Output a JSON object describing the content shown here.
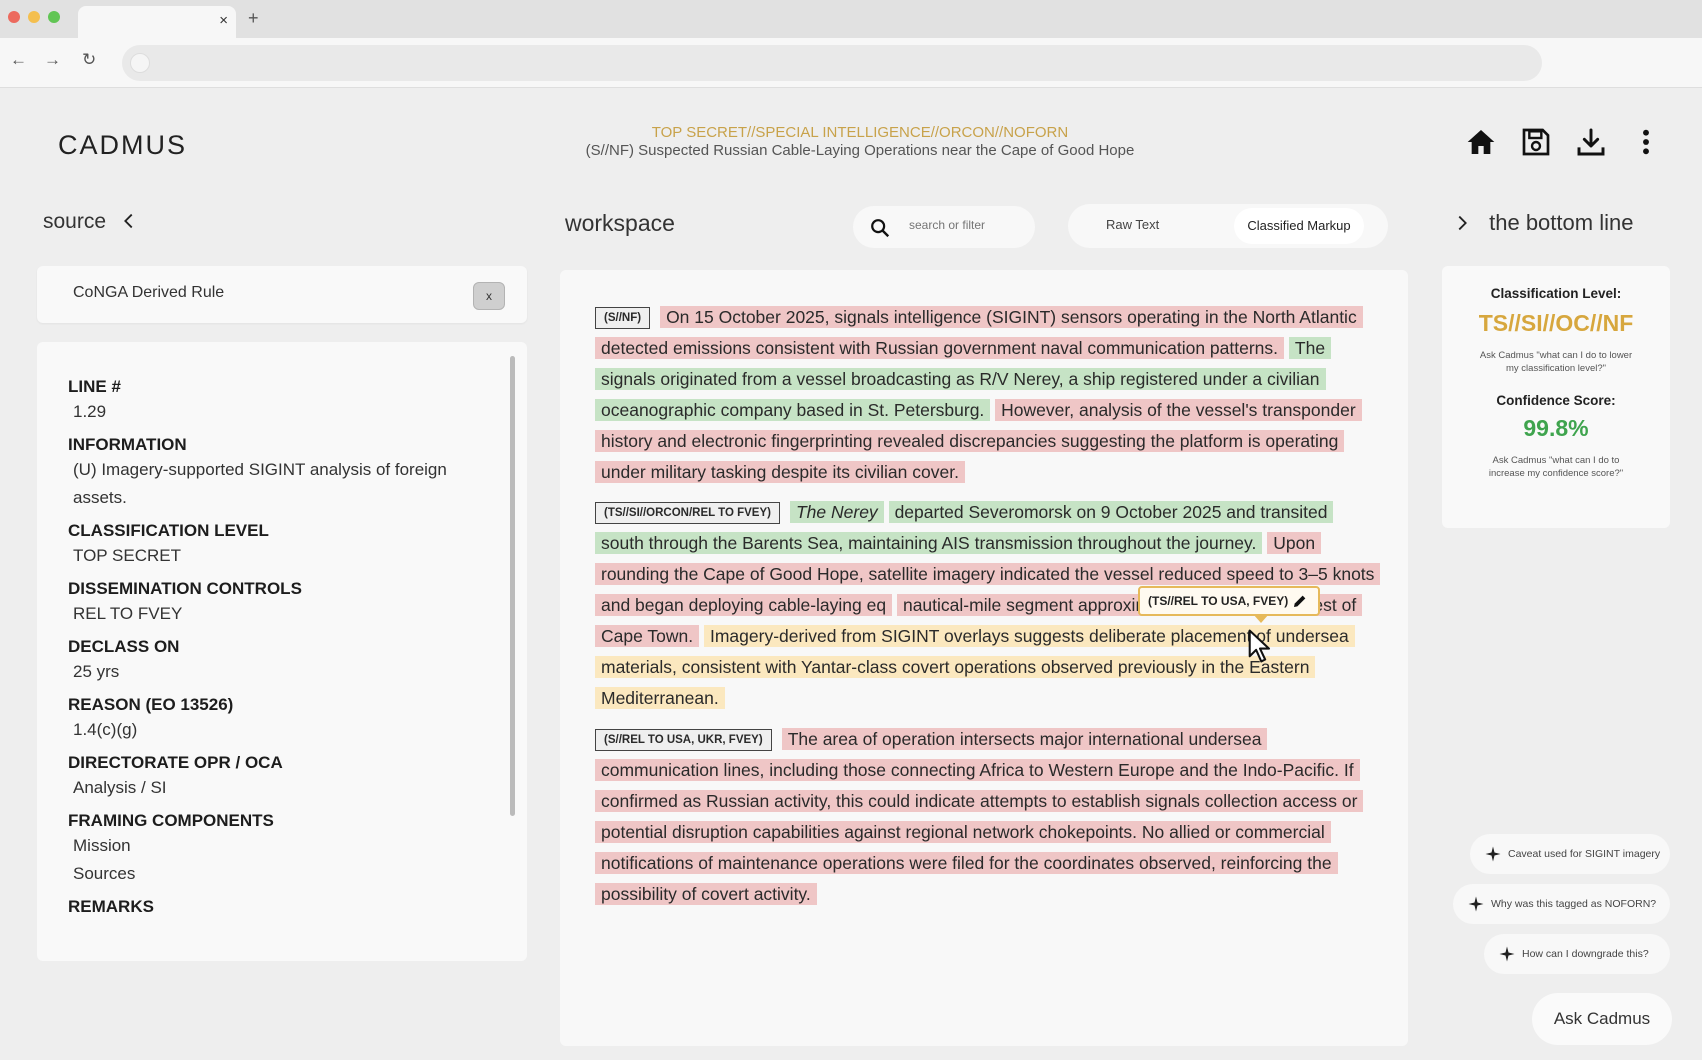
{
  "browser": {
    "tab_close": "×",
    "new_tab": "+",
    "back": "←",
    "forward": "→",
    "reload": "↻"
  },
  "header": {
    "logo": "CADMUS",
    "classification_banner": "TOP SECRET//SPECIAL INTELLIGENCE//ORCON//NOFORN",
    "document_title": "(S//NF) Suspected Russian Cable-Laying Operations near the Cape of Good Hope",
    "icons": [
      "home-icon",
      "save-icon",
      "download-icon",
      "more-vertical-icon"
    ]
  },
  "sections": {
    "source": "source",
    "workspace": "workspace",
    "bottom_line": "the bottom line"
  },
  "search": {
    "placeholder": "search or filter"
  },
  "view_toggle": {
    "raw": "Raw Text",
    "classified": "Classified Markup",
    "selected": "Classified Markup"
  },
  "source_panel": {
    "rule_label": "CoNGA Derived Rule",
    "rule_close": "x",
    "fields": [
      {
        "label": "LINE #",
        "values": [
          "1.29"
        ]
      },
      {
        "label": "INFORMATION",
        "values": [
          "(U) Imagery-supported SIGINT analysis of foreign assets."
        ]
      },
      {
        "label": "CLASSIFICATION LEVEL",
        "values": [
          "TOP SECRET"
        ]
      },
      {
        "label": "DISSEMINATION CONTROLS",
        "values": [
          "REL TO FVEY"
        ]
      },
      {
        "label": "DECLASS ON",
        "values": [
          "25 yrs"
        ]
      },
      {
        "label": "REASON (EO 13526)",
        "values": [
          "1.4(c)(g)"
        ]
      },
      {
        "label": "DIRECTORATE OPR / OCA",
        "values": [
          "Analysis / SI"
        ]
      },
      {
        "label": "FRAMING COMPONENTS",
        "values": [
          "Mission",
          "Sources"
        ]
      },
      {
        "label": "REMARKS",
        "values": []
      }
    ]
  },
  "workspace": {
    "paragraphs": [
      {
        "tag": "(S//NF)",
        "segments": [
          {
            "hl": "red",
            "italic": false,
            "text": "On 15 October 2025, signals intelligence (SIGINT) sensors operating in the North Atlantic detected emissions consistent with Russian government naval communication patterns."
          },
          {
            "hl": "green",
            "italic": false,
            "text": "The signals originated from a vessel broadcasting as R/V Nerey, a ship registered under a civilian oceanographic company based in St. Petersburg."
          },
          {
            "hl": "red",
            "italic": false,
            "text": "However, analysis of the vessel's transponder history and electronic fingerprinting revealed discrepancies suggesting the platform is operating under military tasking despite its civilian cover."
          }
        ]
      },
      {
        "tag": "(TS//SI//ORCON/REL TO FVEY)",
        "segments": [
          {
            "hl": "green",
            "italic": true,
            "text": "The Nerey"
          },
          {
            "hl": "green",
            "italic": false,
            "text": " departed Severomorsk on 9 October 2025 and transited south through the Barents Sea, maintaining AIS transmission throughout the journey."
          },
          {
            "hl": "red",
            "italic": false,
            "text": "Upon rounding the Cape of Good Hope, satellite imagery indicated the vessel reduced speed to 3–5 knots and began deploying cable-laying eq"
          },
          {
            "hl": "red",
            "italic": false,
            "text": "nautical-mile segment approximately 320 NM southwest of Cape Town."
          },
          {
            "hl": "yellow",
            "italic": false,
            "text": "Imagery-derived from SIGINT overlays suggests deliberate placement of undersea materials, consistent with Yantar-class covert operations observed previously in the Eastern Mediterranean."
          }
        ]
      },
      {
        "tag": "(S//REL TO USA, UKR, FVEY)",
        "segments": [
          {
            "hl": "red",
            "italic": false,
            "text": "The area of operation intersects major international undersea communication lines, including those connecting Africa to Western Europe and the Indo-Pacific. If confirmed as Russian activity, this could indicate attempts to establish signals collection access or potential disruption capabilities against regional network chokepoints. No allied or commercial notifications of maintenance operations were filed for the coordinates observed, reinforcing the possibility of covert activity."
          }
        ]
      }
    ],
    "popover_tag": "(TS//REL TO USA, FVEY)"
  },
  "bottom_line": {
    "classification_label": "Classification Level:",
    "classification_value": "TS//SI//OC//NF",
    "ask_lower": "Ask Cadmus \"what can I do to lower my classification level?\"",
    "confidence_label": "Confidence Score:",
    "confidence_value": "99.8%",
    "ask_increase": "Ask Cadmus \"what can I do to increase my confidence score?\""
  },
  "suggestions": [
    "Caveat used for SIGINT imagery",
    "Why was this tagged as NOFORN?",
    "How can I downgrade this?"
  ],
  "ask_button": "Ask Cadmus",
  "colors": {
    "accent_gold": "#d7a73e",
    "confidence_green": "#3fa44e",
    "highlight_red": "#efc6c6",
    "highlight_green": "#c6e3c5",
    "highlight_yellow": "#fbe8bf"
  }
}
